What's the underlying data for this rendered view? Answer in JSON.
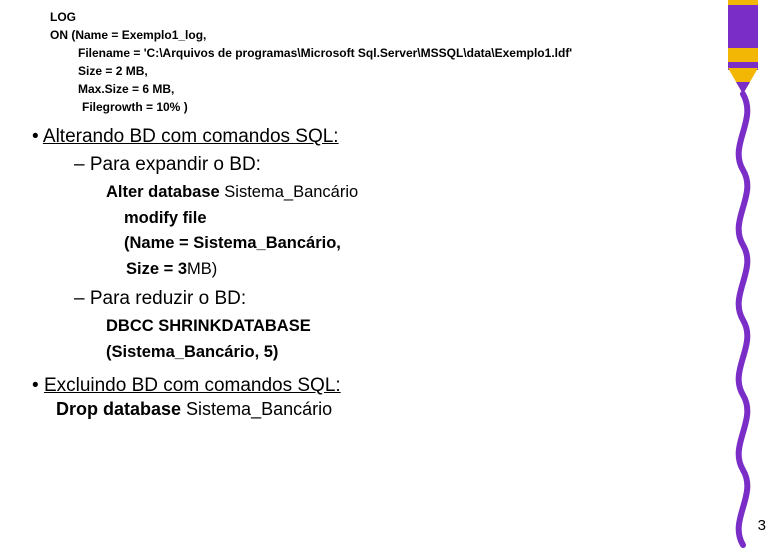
{
  "log": {
    "kw_log": "LOG",
    "on_name": "ON (Name = Exemplo1_log,",
    "filename": "Filename = 'C:\\Arquivos de programas\\Microsoft Sql.Server\\MSSQL\\data\\Exemplo1.ldf'",
    "size": "Size = 2 MB,",
    "maxsize": "Max.Size = 6 MB,",
    "filegrowth": "Filegrowth = 10% )"
  },
  "sections": {
    "alter_heading": "Alterando BD com comandos SQL:",
    "expand_heading": "Para expandir o BD:",
    "reduce_heading": "Para reduzir o BD:",
    "exclude_heading": "Excluindo BD com comandos SQL:"
  },
  "alter": {
    "l1a": "Alter database ",
    "l1b": "Sistema_Bancário",
    "l2": "modify file",
    "l3": "(Name = Sistema_Bancário,",
    "l4a": "Size = 3",
    "l4b": "MB)"
  },
  "dbcc": {
    "l1": "DBCC SHRINKDATABASE",
    "l2": "(Sistema_Bancário, 5)"
  },
  "drop": {
    "l1a": "Drop database ",
    "l1b": "Sistema_Bancário"
  },
  "page_number": "3",
  "crayon_color": "#7a2ec7"
}
